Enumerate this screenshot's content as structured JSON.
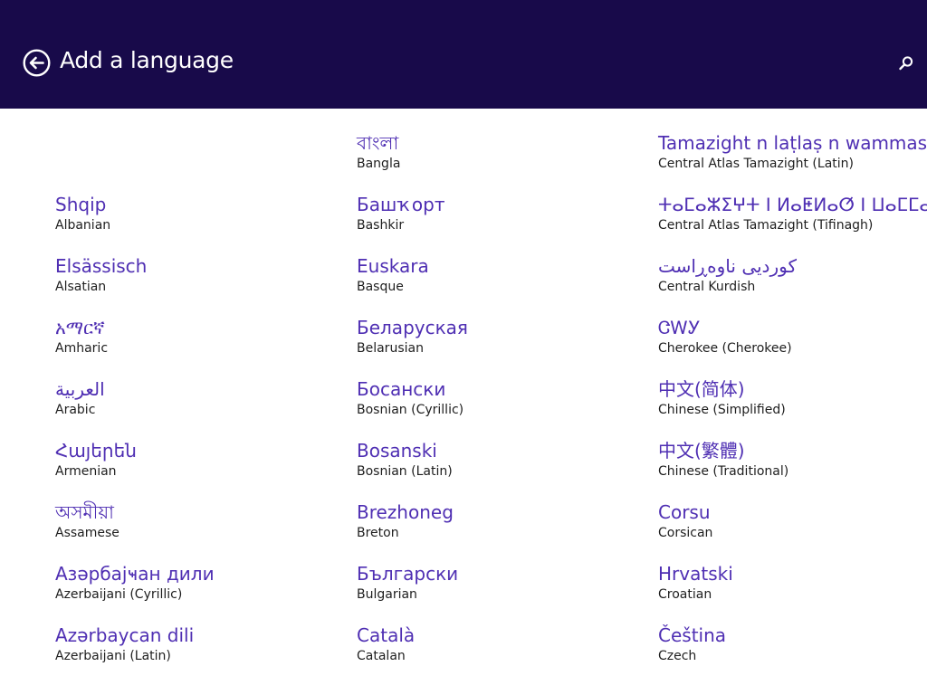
{
  "header": {
    "title": "Add a language",
    "back_icon": "back-arrow-circle-icon",
    "search_icon": "search-icon",
    "background": "#180a4a"
  },
  "colors": {
    "native_text": "#4f2fb3",
    "english_text": "#1e1e1e"
  },
  "columns": [
    {
      "items": [
        {
          "native": "",
          "english": ""
        },
        {
          "native": "Shqip",
          "english": "Albanian"
        },
        {
          "native": "Elsässisch",
          "english": "Alsatian"
        },
        {
          "native": "አማርኛ",
          "english": "Amharic"
        },
        {
          "native": "العربية",
          "english": "Arabic"
        },
        {
          "native": "Հայերեն",
          "english": "Armenian"
        },
        {
          "native": "অসমীয়া",
          "english": "Assamese"
        },
        {
          "native": "Азәрбајҹан дили",
          "english": "Azerbaijani (Cyrillic)"
        },
        {
          "native": "Azərbaycan dili",
          "english": "Azerbaijani (Latin)"
        }
      ]
    },
    {
      "items": [
        {
          "native": "বাংলা",
          "english": "Bangla"
        },
        {
          "native": "Башҡорт",
          "english": "Bashkir"
        },
        {
          "native": "Euskara",
          "english": "Basque"
        },
        {
          "native": "Беларуская",
          "english": "Belarusian"
        },
        {
          "native": "Босански",
          "english": "Bosnian (Cyrillic)"
        },
        {
          "native": "Bosanski",
          "english": "Bosnian (Latin)"
        },
        {
          "native": "Brezhoneg",
          "english": "Breton"
        },
        {
          "native": "Български",
          "english": "Bulgarian"
        },
        {
          "native": "Català",
          "english": "Catalan"
        }
      ]
    },
    {
      "items": [
        {
          "native": "Tamazight n laṭlaṣ n wammas",
          "english": "Central Atlas Tamazight (Latin)"
        },
        {
          "native": "ⵜⴰⵎⴰⵣⵉⵖⵜ ⵏ ⵍⴰⵟⵍⴰⵚ ⵏ ⵡⴰⵎⵎⴰⵙ",
          "english": "Central Atlas Tamazight (Tifinagh)"
        },
        {
          "native": "کوردیی ناوەڕاست",
          "english": "Central Kurdish"
        },
        {
          "native": "ᏣᎳᎩ",
          "english": "Cherokee (Cherokee)"
        },
        {
          "native": "中文(简体)",
          "english": "Chinese (Simplified)"
        },
        {
          "native": "中文(繁體)",
          "english": "Chinese (Traditional)"
        },
        {
          "native": "Corsu",
          "english": "Corsican"
        },
        {
          "native": "Hrvatski",
          "english": "Croatian"
        },
        {
          "native": "Čeština",
          "english": "Czech"
        }
      ]
    }
  ]
}
